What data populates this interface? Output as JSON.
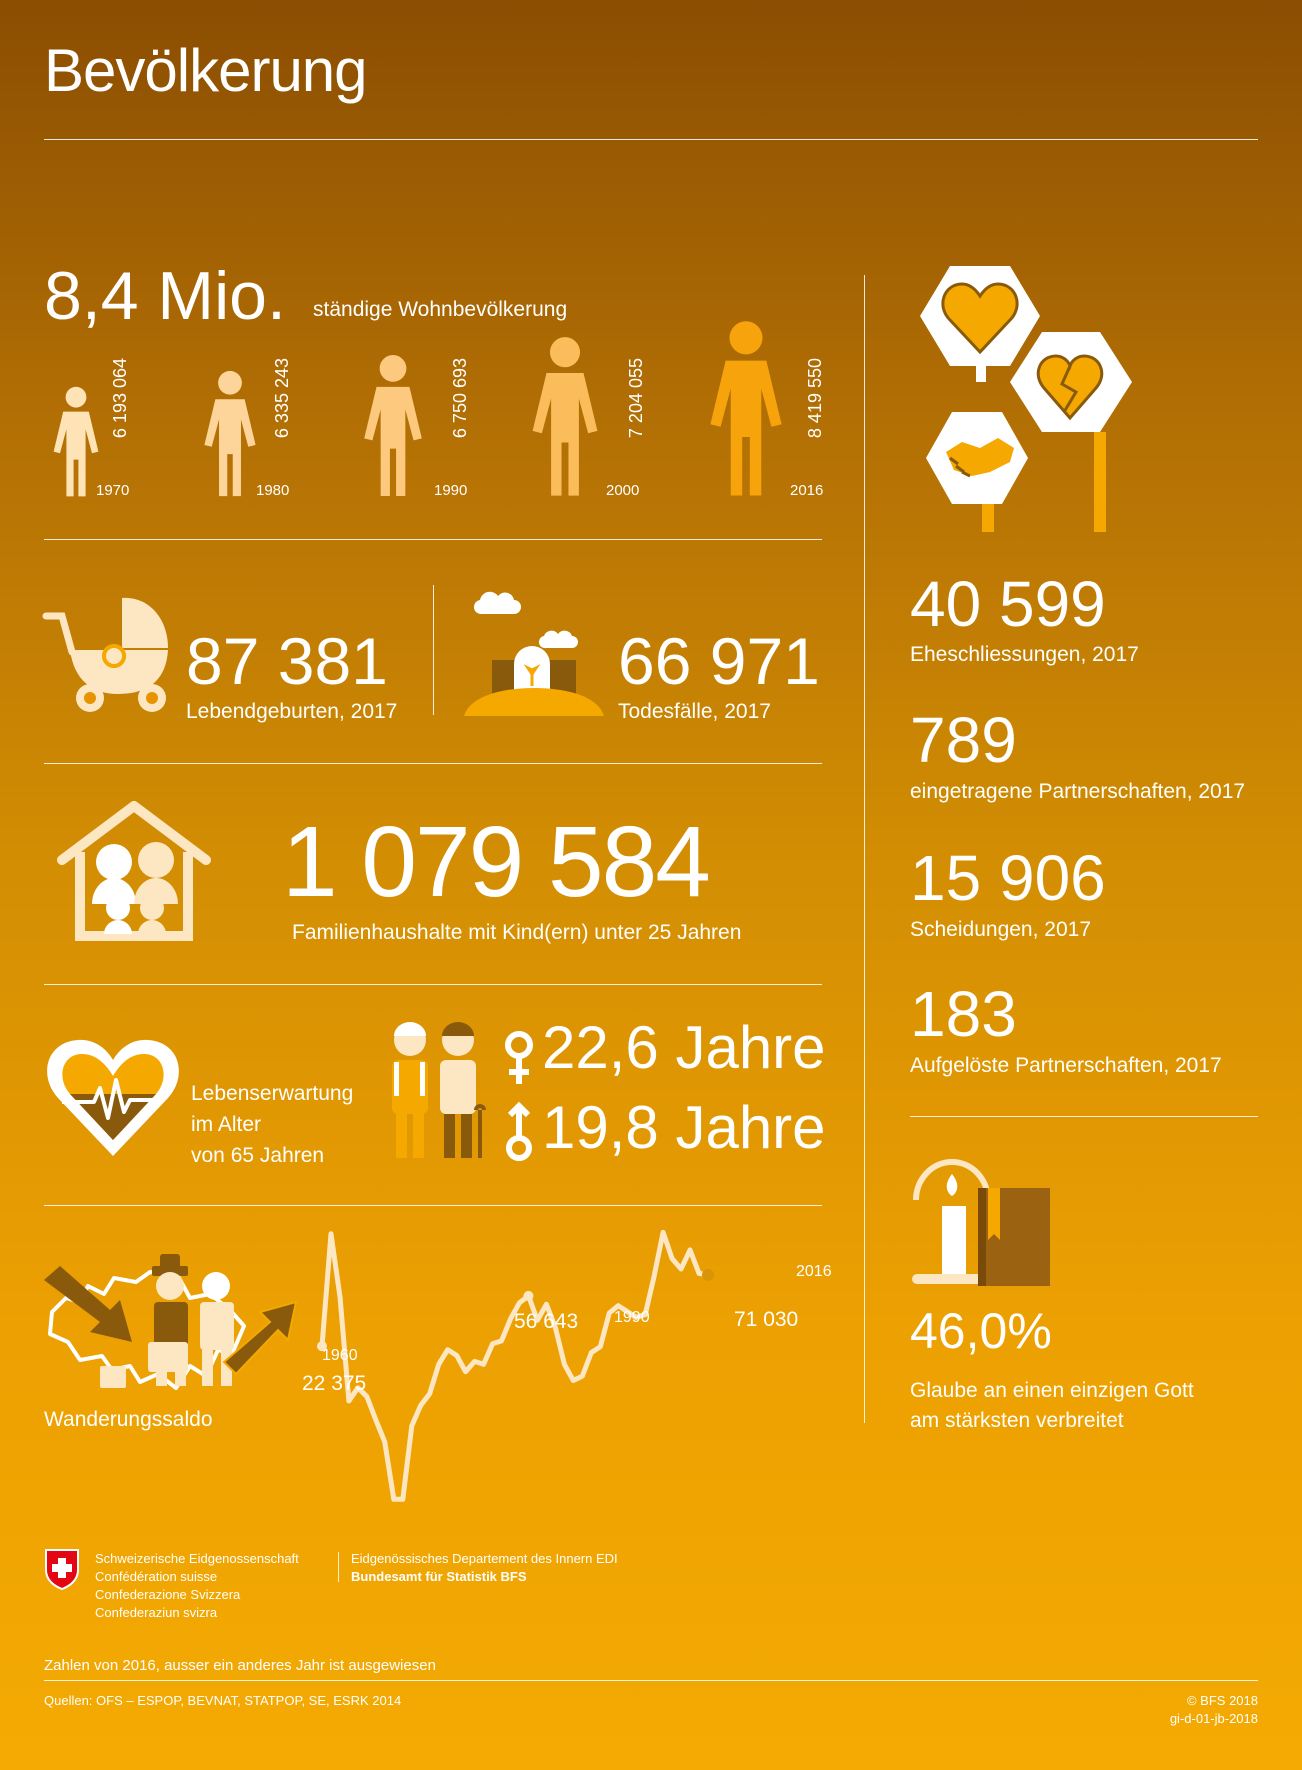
{
  "title": "Bevölkerung",
  "population": {
    "headline": "8,4 Mio.",
    "headline_label": "ständige Wohnbevölkerung",
    "figures": [
      {
        "year": "1970",
        "value": "6 193 064"
      },
      {
        "year": "1980",
        "value": "6 335 243"
      },
      {
        "year": "1990",
        "value": "6 750 693"
      },
      {
        "year": "2000",
        "value": "7 204 055"
      },
      {
        "year": "2016",
        "value": "8 419 550"
      }
    ],
    "figure_colors": [
      "#fde3b5",
      "#fdd59a",
      "#fcc97e",
      "#fbbd5c",
      "#f7a40c"
    ]
  },
  "births": {
    "value": "87 381",
    "label": "Lebendgeburten, 2017"
  },
  "deaths": {
    "value": "66 971",
    "label": "Todesfälle, 2017"
  },
  "households": {
    "value": "1 079 584",
    "label": "Familienhaushalte mit Kind(ern) unter 25 Jahren"
  },
  "life_expectancy": {
    "label_lines": [
      "Lebenserwartung",
      "im Alter",
      "von 65 Jahren"
    ],
    "female": "22,6 Jahre",
    "male": "19,8 Jahre"
  },
  "migration": {
    "label": "Wanderungssaldo",
    "annotations": {
      "start_year": "1960",
      "start_value": "22 375",
      "mid_value": "56 643",
      "mid_year": "1990",
      "end_value": "71 030",
      "end_year": "2016"
    }
  },
  "chart_data": {
    "type": "line",
    "title": "",
    "series": [
      {
        "name": "Wanderungssaldo",
        "values": [
          22375,
          99000,
          56000,
          -15000,
          -6000,
          -12000,
          -28000,
          -43000,
          -82000,
          -82000,
          -32000,
          -18000,
          -10000,
          10000,
          20000,
          16000,
          5000,
          12000,
          10000,
          24000,
          26000,
          41000,
          52000,
          56643,
          40000,
          51000,
          35000,
          10000,
          -1000,
          2000,
          18000,
          22000,
          45000,
          50000,
          46000,
          42000,
          44000,
          70000,
          100000,
          82000,
          75000,
          88000,
          72000,
          71030
        ]
      }
    ],
    "xlim": [
      1960,
      2016
    ],
    "labeled_points": [
      {
        "x": 1960,
        "y": 22375
      },
      {
        "x": 1990,
        "y": 56643
      },
      {
        "x": 2016,
        "y": 71030
      }
    ],
    "grid": false,
    "axes_visible": false
  },
  "sidebar": {
    "stats": [
      {
        "value": "40 599",
        "label": "Eheschliessungen, 2017"
      },
      {
        "value": "789",
        "label": "eingetragene Partnerschaften, 2017"
      },
      {
        "value": "15 906",
        "label": "Scheidungen, 2017"
      },
      {
        "value": "183",
        "label": "Aufgelöste Partnerschaften, 2017"
      }
    ],
    "religion": {
      "value": "46,0%",
      "label_lines": [
        "Glaube an einen einzigen Gott",
        "am stärksten verbreitet"
      ]
    }
  },
  "footer": {
    "confederation_lines": [
      "Schweizerische Eidgenossenschaft",
      "Confédération suisse",
      "Confederazione Svizzera",
      "Confederaziun svizra"
    ],
    "department": "Eidgenössisches Departement des Innern EDI",
    "office": "Bundesamt für Statistik BFS",
    "note": "Zahlen von 2016, ausser ein anderes Jahr ist ausgewiesen",
    "sources": "Quellen: OFS – ESPOP, BEVNAT, STATPOP, SE, ESRK 2014",
    "copyright": "© BFS 2018",
    "code": "gi-d-01-jb-2018"
  },
  "colors": {
    "light": "#fde7c2",
    "accent": "#f4a800",
    "dark": "#8a5a0c",
    "brown": "#9b6212"
  }
}
